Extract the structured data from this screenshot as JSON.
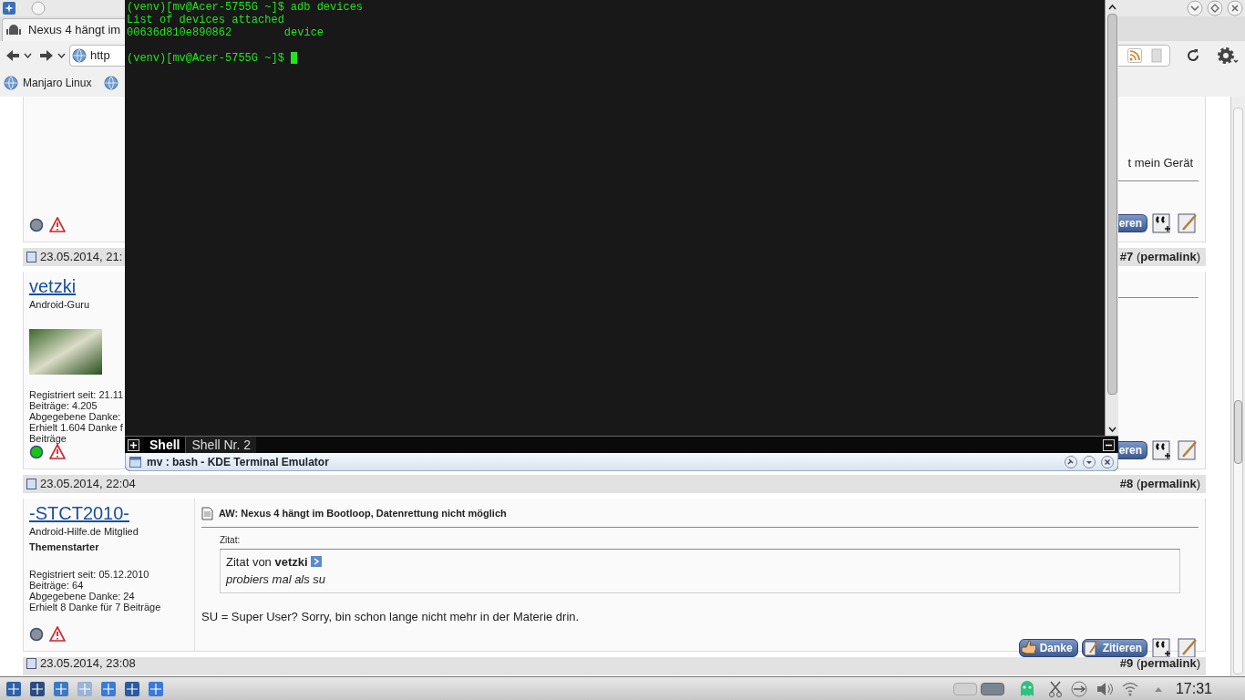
{
  "tabs": [
    {
      "label": "Nexus 4 hängt im",
      "selected": true
    }
  ],
  "address": {
    "value": "http"
  },
  "bookmarks": [
    {
      "label": "Manjaro Linux",
      "kind": "globe"
    }
  ],
  "posts": [
    {
      "user": {
        "online": false
      },
      "body": [
        {
          "kind": "fragment",
          "text": "t mein Gerät"
        },
        {
          "kind": "rule"
        }
      ],
      "buttons": [
        {
          "label": "eren",
          "kind": "quote_cut"
        }
      ]
    },
    {
      "header": {
        "date": "23.05.2014, 21:",
        "number": "**#7** (**permalink**)"
      },
      "user": {
        "name": "vetzki",
        "title": "Android-Guru",
        "avatar": true,
        "stats": [
          "Registriert seit: 21.11",
          "Beiträge: 4.205",
          "Abgegebene Danke:",
          "Erhielt 1.604 Danke f",
          "Beiträge"
        ],
        "online": true
      },
      "body": [
        {
          "kind": "rule"
        }
      ],
      "buttons": [
        {
          "label": "eren",
          "kind": "quote_cut"
        }
      ]
    },
    {
      "header": {
        "date": "23.05.2014, 22:04",
        "number": "**#8** (**permalink**)"
      },
      "user": {
        "name": "-STCT2010-",
        "title": "Android-Hilfe.de Mitglied",
        "rank": "Themenstarter",
        "stats": [
          "Registriert seit: 05.12.2010",
          "Beiträge: 64",
          "Abgegebene Danke: 24",
          "Erhielt 8 Danke für 7 Beiträge"
        ],
        "online": false
      },
      "body": [
        {
          "kind": "title",
          "text": "AW: Nexus 4 hängt im Bootloop, Datenrettung nicht möglich"
        },
        {
          "kind": "quote",
          "label": "Zitat:",
          "author": "Zitat von **vetzki**",
          "text": "probiers mal als su"
        },
        {
          "kind": "text",
          "text": "SU = Super User? Sorry, bin schon lange nicht mehr in der Materie drin."
        }
      ],
      "buttons": [
        {
          "label": "Danke",
          "kind": "thanks"
        },
        {
          "label": "Zitieren",
          "kind": "quote"
        }
      ]
    },
    {
      "header": {
        "date": "23.05.2014, 23:08",
        "number": "**#9** (**permalink**)"
      }
    }
  ],
  "terminal": {
    "lines": [
      {
        "kind": "command",
        "prompt": "(venv)[mv@Acer-5755G ~]$",
        "text": "adb devices"
      },
      {
        "kind": "output",
        "text": "List of devices attached"
      },
      {
        "kind": "output",
        "text": "00636d810e890862        device"
      },
      {
        "kind": "blank"
      },
      {
        "kind": "cursor",
        "prompt": "(venv)[mv@Acer-5755G ~]$"
      }
    ],
    "tabs": [
      {
        "label": "Shell",
        "selected": true
      },
      {
        "label": "Shell Nr. 2",
        "selected": false
      }
    ],
    "title": "mv : bash - KDE Terminal Emulator"
  },
  "taskbar": {
    "clock": "17:31"
  }
}
